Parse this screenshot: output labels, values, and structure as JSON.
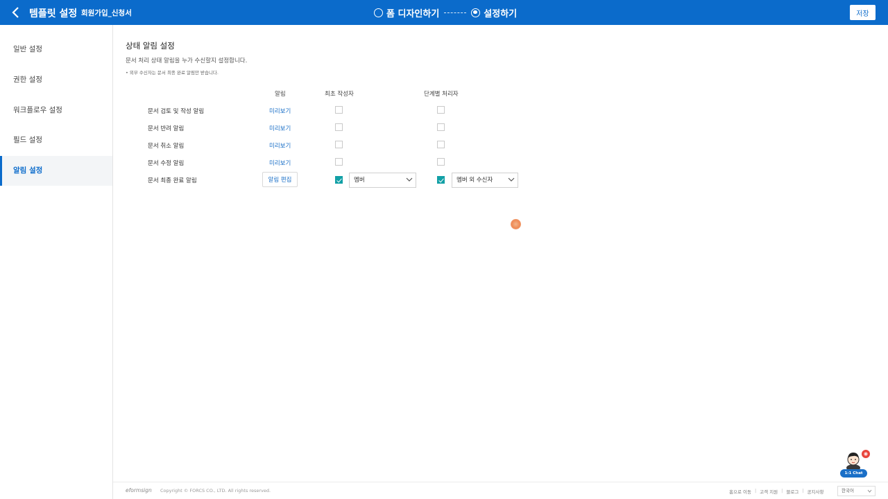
{
  "header": {
    "title": "템플릿 설정",
    "subtitle": "회원가입_신청서",
    "step1": "폼 디자인하기",
    "step2": "설정하기",
    "save": "저장"
  },
  "sidebar": {
    "items": [
      {
        "label": "일반 설정",
        "active": false
      },
      {
        "label": "권한 설정",
        "active": false
      },
      {
        "label": "워크플로우 설정",
        "active": false
      },
      {
        "label": "필드 설정",
        "active": false
      },
      {
        "label": "알림 설정",
        "active": true
      }
    ]
  },
  "main": {
    "title": "상태 알림 설정",
    "desc": "문서 처리 상태 알림을 누가 수신할지 설정합니다.",
    "note": "• 외부 수신자는 문서 최종 완료 알림만 받습니다.",
    "columns": {
      "alarm": "알림",
      "creator": "최초 작성자",
      "step": "단계별 처리자"
    },
    "rows": [
      {
        "label": "문서 검토 및 작성 알림",
        "action": "미리보기",
        "creator_checked": false,
        "step_checked": false
      },
      {
        "label": "문서 반려 알림",
        "action": "미리보기",
        "creator_checked": false,
        "step_checked": false
      },
      {
        "label": "문서 취소 알림",
        "action": "미리보기",
        "creator_checked": false,
        "step_checked": false
      },
      {
        "label": "문서 수정 알림",
        "action": "미리보기",
        "creator_checked": false,
        "step_checked": false
      },
      {
        "label": "문서 최종 완료 알림",
        "action": "알림 편집",
        "creator_checked": true,
        "step_checked": true,
        "creator_select": "멤버",
        "step_select": "멤버 외 수신자"
      }
    ]
  },
  "footer": {
    "logo": "eformsign",
    "copyright": "Copyright © FORCS CO., LTD. All rights reserved.",
    "links": [
      "홈으로 이동",
      "고객 지원",
      "블로그",
      "공지사항"
    ],
    "language": "한국어"
  },
  "chat": {
    "label": "1:1 Chat"
  },
  "colors": {
    "primary": "#0b6bcb",
    "check": "#12a0a6",
    "link": "#1a6fc7"
  }
}
